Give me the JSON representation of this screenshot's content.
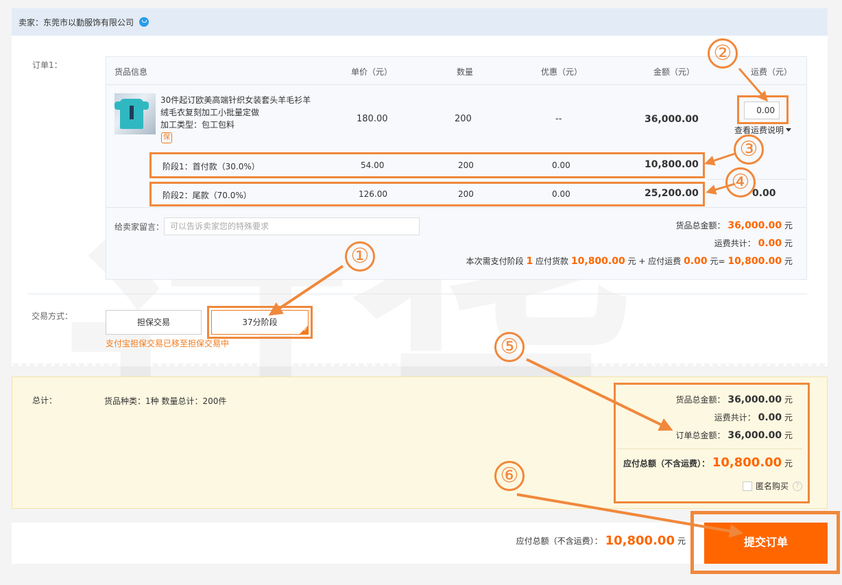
{
  "seller": {
    "label": "卖家：东莞市以勤服饰有限公司"
  },
  "order": {
    "label": "订单1：",
    "headers": {
      "product": "货品信息",
      "unit_price": "单价（元）",
      "quantity": "数量",
      "discount": "优惠（元）",
      "amount": "金额（元）",
      "freight": "运费（元）"
    },
    "product": {
      "title_line1": "30件起订欧美高端针织女装套头羊毛衫羊",
      "title_line2": "绒毛衣复刻加工小批量定做",
      "process_type": "加工类型：包工包料",
      "bao_badge": "保",
      "unit_price": "180.00",
      "quantity": "200",
      "discount": "--",
      "amount": "36,000.00",
      "freight_value": "0.00",
      "freight_note": "查看运费说明"
    },
    "stages": [
      {
        "name": "阶段1：首付款（30.0%）",
        "unit_price": "54.00",
        "quantity": "200",
        "discount": "0.00",
        "amount": "10,800.00",
        "freight": ""
      },
      {
        "name": "阶段2：尾款（70.0%）",
        "unit_price": "126.00",
        "quantity": "200",
        "discount": "0.00",
        "amount": "25,200.00",
        "freight": "0.00"
      }
    ],
    "message": {
      "label": "给卖家留言：",
      "placeholder": "可以告诉卖家您的特殊要求"
    },
    "summary": {
      "goods_total_label": "货品总金额：",
      "goods_total": "36,000.00",
      "unit": "元",
      "freight_label": "运费共计：",
      "freight_total": "0.00",
      "stage_pay_prefix": "本次需支付阶段",
      "stage_no": "1",
      "stage_pay_goods_label": "应付货款",
      "stage_pay_goods": "10,800.00",
      "stage_pay_unit1": "元 + 应付运费",
      "stage_pay_freight": "0.00",
      "stage_pay_unit2": "元=",
      "stage_pay_total": "10,800.00"
    }
  },
  "trade": {
    "label": "交易方式：",
    "options": [
      "担保交易",
      "37分阶段"
    ],
    "note": "支付宝担保交易已移至担保交易中"
  },
  "totals": {
    "label": "总计：",
    "info": "货品种类：1种   数量总计：200件",
    "goods_total_label": "货品总金额：",
    "goods_total": "36,000.00",
    "freight_label": "运费共计：",
    "freight_total": "0.00",
    "order_total_label": "订单总金额：",
    "order_total": "36,000.00",
    "payable_label": "应付总额（不含运费）：",
    "payable": "10,800.00",
    "unit": "元",
    "anonymous": "匿名购买",
    "help": "?"
  },
  "footer": {
    "payable_label": "应付总额（不含运费）：",
    "payable": "10,800.00",
    "unit": "元",
    "submit": "提交订单"
  },
  "annotations": [
    "①",
    "②",
    "③",
    "④",
    "⑤",
    "⑥"
  ],
  "watermark": "订货",
  "colors": {
    "accent": "#ff6600",
    "annotation": "#f0883c",
    "seller_bar": "#e3ecf6",
    "total_bg": "#fdf8e1"
  }
}
